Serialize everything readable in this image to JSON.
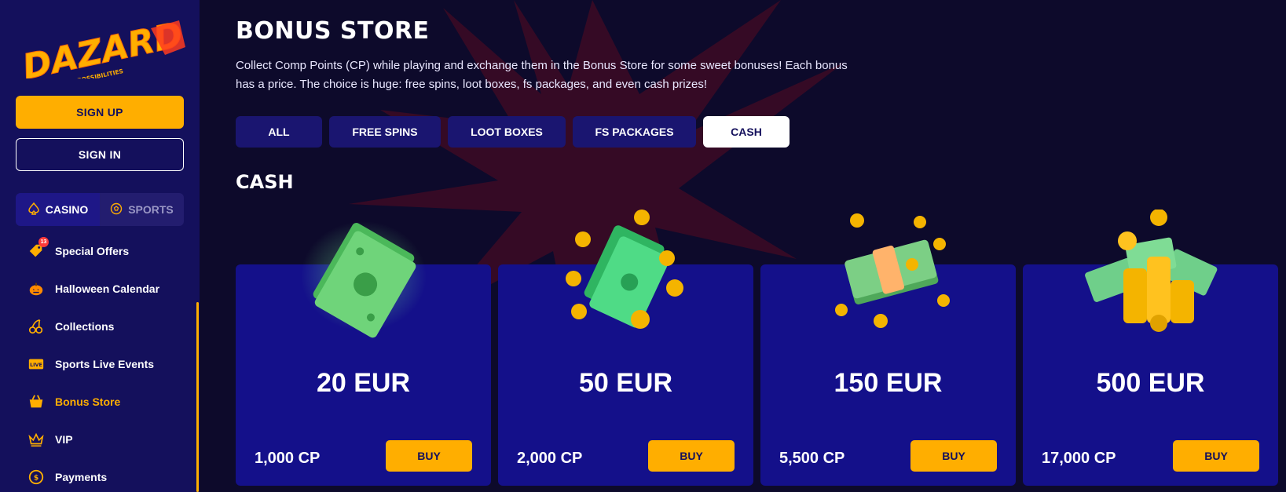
{
  "sidebar": {
    "logo": {
      "brand": "DAZARD",
      "tagline": "THE CASINO OF POSSIBILITIES"
    },
    "signup_label": "SIGN UP",
    "signin_label": "SIGN IN",
    "modes": [
      {
        "label": "CASINO",
        "active": true
      },
      {
        "label": "SPORTS",
        "active": false
      }
    ],
    "nav_items": [
      {
        "label": "Special Offers",
        "icon": "tag-icon",
        "badge": "13"
      },
      {
        "label": "Halloween Calendar",
        "icon": "pumpkin-icon"
      },
      {
        "label": "Collections",
        "icon": "cherries-icon"
      },
      {
        "label": "Sports Live Events",
        "icon": "live-tv-icon",
        "icon_text": "LIVE"
      },
      {
        "label": "Bonus Store",
        "icon": "basket-icon",
        "active": true
      },
      {
        "label": "VIP",
        "icon": "crown-icon"
      },
      {
        "label": "Payments",
        "icon": "coin-icon"
      }
    ]
  },
  "main": {
    "title": "BONUS STORE",
    "description": "Collect Comp Points (CP) while playing and exchange them in the Bonus Store for some sweet bonuses! Each bonus has a price. The choice is huge: free spins, loot boxes, fs packages, and even cash prizes!",
    "filters": [
      {
        "label": "ALL",
        "active": false
      },
      {
        "label": "FREE SPINS",
        "active": false
      },
      {
        "label": "LOOT BOXES",
        "active": false
      },
      {
        "label": "FS PACKAGES",
        "active": false
      },
      {
        "label": "CASH",
        "active": true
      }
    ],
    "section_title": "CASH",
    "cards": [
      {
        "amount": "20 EUR",
        "price": "1,000 CP",
        "buy_label": "BUY",
        "art": "cash-bills-icon"
      },
      {
        "amount": "50 EUR",
        "price": "2,000 CP",
        "buy_label": "BUY",
        "art": "cash-coins-icon"
      },
      {
        "amount": "150 EUR",
        "price": "5,500 CP",
        "buy_label": "BUY",
        "art": "cash-stack-icon"
      },
      {
        "amount": "500 EUR",
        "price": "17,000 CP",
        "buy_label": "BUY",
        "art": "cash-pile-icon"
      }
    ]
  },
  "colors": {
    "accent": "#ffae00",
    "sidebar_bg": "#14105c",
    "page_bg": "#0d0a2b",
    "card_bg": "#14108a",
    "burst": "#4a0f2a"
  }
}
